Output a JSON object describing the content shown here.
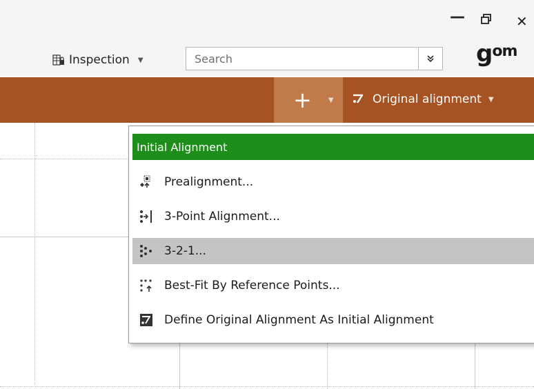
{
  "window": {
    "minimize_symbol": "—",
    "maximize_symbol": "🗗",
    "close_symbol": "✕"
  },
  "header": {
    "mode_label": "Inspection",
    "mode_icon": "inspection-table-icon",
    "search_placeholder": "Search",
    "search_expand_symbol": "≚",
    "logo_text_main": "g",
    "logo_text_sup": "om"
  },
  "toolbar": {
    "add_symbol": "+",
    "dropdown_symbol": "▼",
    "alignment_label": "Original alignment",
    "alignment_icon": "original-alignment-icon",
    "accent_color": "#a65222",
    "add_bg_color": "#c17a49"
  },
  "menu": {
    "header": "Initial Alignment",
    "header_color": "#1e8e1a",
    "items": [
      {
        "label": "Prealignment...",
        "icon": "prealignment-icon",
        "highlighted": false
      },
      {
        "label": "3-Point Alignment...",
        "icon": "three-point-alignment-icon",
        "highlighted": false
      },
      {
        "label": "3-2-1...",
        "icon": "three-two-one-icon",
        "highlighted": true
      },
      {
        "label": "Best-Fit By Reference Points...",
        "icon": "best-fit-icon",
        "highlighted": false
      },
      {
        "label": "Define Original Alignment As Initial Alignment",
        "icon": "define-original-alignment-icon",
        "highlighted": false
      }
    ]
  }
}
